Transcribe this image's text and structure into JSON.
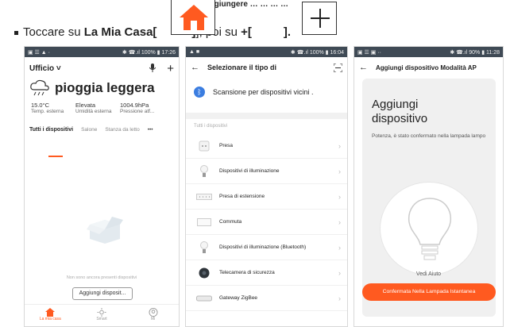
{
  "instruction": {
    "prefix": "Toccare su ",
    "home_label": "La Mia Casa[",
    "mid": "], poi su ",
    "plus_label": "+[",
    "suffix": "]."
  },
  "top_clip": "aggiungere …   … …  …",
  "phone1": {
    "status": {
      "left": "▣ ☰ ▲ ·",
      "right": "✱ ☎.ıl 100% ▮ 17:26"
    },
    "title": "Ufficio ˅",
    "weather": "pioggia leggera",
    "stats": [
      {
        "value": "15.0°C",
        "label": "Temp. esterna"
      },
      {
        "value": "Elevata",
        "label": "Umidità esterna"
      },
      {
        "value": "1004.9hPa",
        "label": "Pressione atf..."
      }
    ],
    "tabs": [
      "Tutti i dispositivi",
      "Salone",
      "Stanza da letto"
    ],
    "more": "•••",
    "empty_text": "Non sono ancora presenti dispositivi",
    "add_button": "Aggiungi disposit...",
    "nav": [
      {
        "icon": "home-icon",
        "label": "La mia casa"
      },
      {
        "icon": "sun-icon",
        "label": "Smart"
      },
      {
        "icon": "profile-icon",
        "label": "Mi"
      }
    ],
    "accent": "#ff5a20"
  },
  "phone2": {
    "status": {
      "left": "▲ ■",
      "right": "✱ ☎.ıl 100% ▮ 16:04"
    },
    "back": "←",
    "title": "Selezionare il tipo di",
    "scan_label": "Scansione per dispositivi vicini .",
    "section": "Tutti i dispositivi",
    "devices": [
      {
        "icon": "plug-icon",
        "name": "Presa"
      },
      {
        "icon": "bulb-icon",
        "name": "Dispositivi di illuminazione"
      },
      {
        "icon": "power-strip-icon",
        "name": "Presa di estensione"
      },
      {
        "icon": "switch-icon",
        "name": "Commuta"
      },
      {
        "icon": "bulb-icon",
        "name": "Dispositivi di illuminazione (Bluetooth)"
      },
      {
        "icon": "camera-icon",
        "name": "Telecamera di sicurezza"
      },
      {
        "icon": "gateway-icon",
        "name": "Gateway ZigBee"
      }
    ],
    "chevron": "›",
    "bt_color": "#3b7de0"
  },
  "phone3": {
    "status": {
      "left": "▣ ☰ ▣ ··",
      "right": "✱ ☎.ıl 90% ▮ 11:28"
    },
    "back": "←",
    "title": "Aggiungi dispositivo",
    "mode": "Modalità AP",
    "heading_line1": "Aggiungi",
    "heading_line2": "dispositivo",
    "description": "Potenza, è stato confermato nella lampada lampo",
    "help": "Vedi Aiuto",
    "confirm_button": "Confermata Nella Lampada Istantanea",
    "accent": "#ff5a20"
  }
}
